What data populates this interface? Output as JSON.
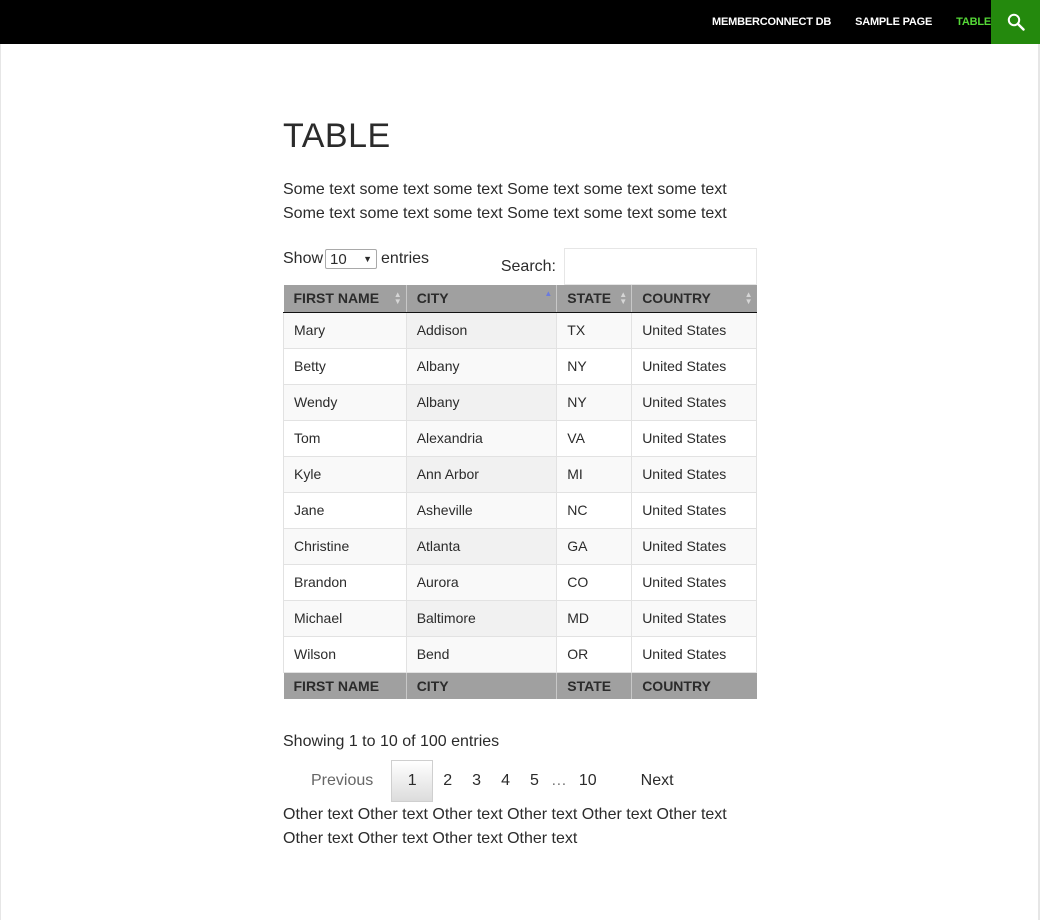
{
  "nav": {
    "items": [
      {
        "label": "MEMBERCONNECT DB",
        "active": false
      },
      {
        "label": "SAMPLE PAGE",
        "active": false
      },
      {
        "label": "TABLE",
        "active": true
      }
    ],
    "search_icon": "search-icon",
    "active_color": "#55d737",
    "search_bg": "#24890d"
  },
  "page": {
    "title": "TABLE",
    "intro": "Some text some text some text Some text some text some text Some text some text some text Some text some text some text",
    "outro": "Other text Other text Other text Other text Other text Other text Other text Other text Other text Other text"
  },
  "controls": {
    "show_label": "Show",
    "length_value": "10",
    "entries_label": "entries",
    "search_label": "Search:",
    "search_value": ""
  },
  "table": {
    "columns": [
      "FIRST NAME",
      "CITY",
      "STATE",
      "COUNTRY"
    ],
    "sorted_column": "CITY",
    "rows": [
      [
        "Mary",
        "Addison",
        "TX",
        "United States"
      ],
      [
        "Betty",
        "Albany",
        "NY",
        "United States"
      ],
      [
        "Wendy",
        "Albany",
        "NY",
        "United States"
      ],
      [
        "Tom",
        "Alexandria",
        "VA",
        "United States"
      ],
      [
        "Kyle",
        "Ann Arbor",
        "MI",
        "United States"
      ],
      [
        "Jane",
        "Asheville",
        "NC",
        "United States"
      ],
      [
        "Christine",
        "Atlanta",
        "GA",
        "United States"
      ],
      [
        "Brandon",
        "Aurora",
        "CO",
        "United States"
      ],
      [
        "Michael",
        "Baltimore",
        "MD",
        "United States"
      ],
      [
        "Wilson",
        "Bend",
        "OR",
        "United States"
      ]
    ]
  },
  "info": "Showing 1 to 10 of 100 entries",
  "pagination": {
    "previous": "Previous",
    "pages": [
      "1",
      "2",
      "3",
      "4",
      "5"
    ],
    "current": "1",
    "ellipsis": "…",
    "last": "10",
    "next": "Next"
  }
}
